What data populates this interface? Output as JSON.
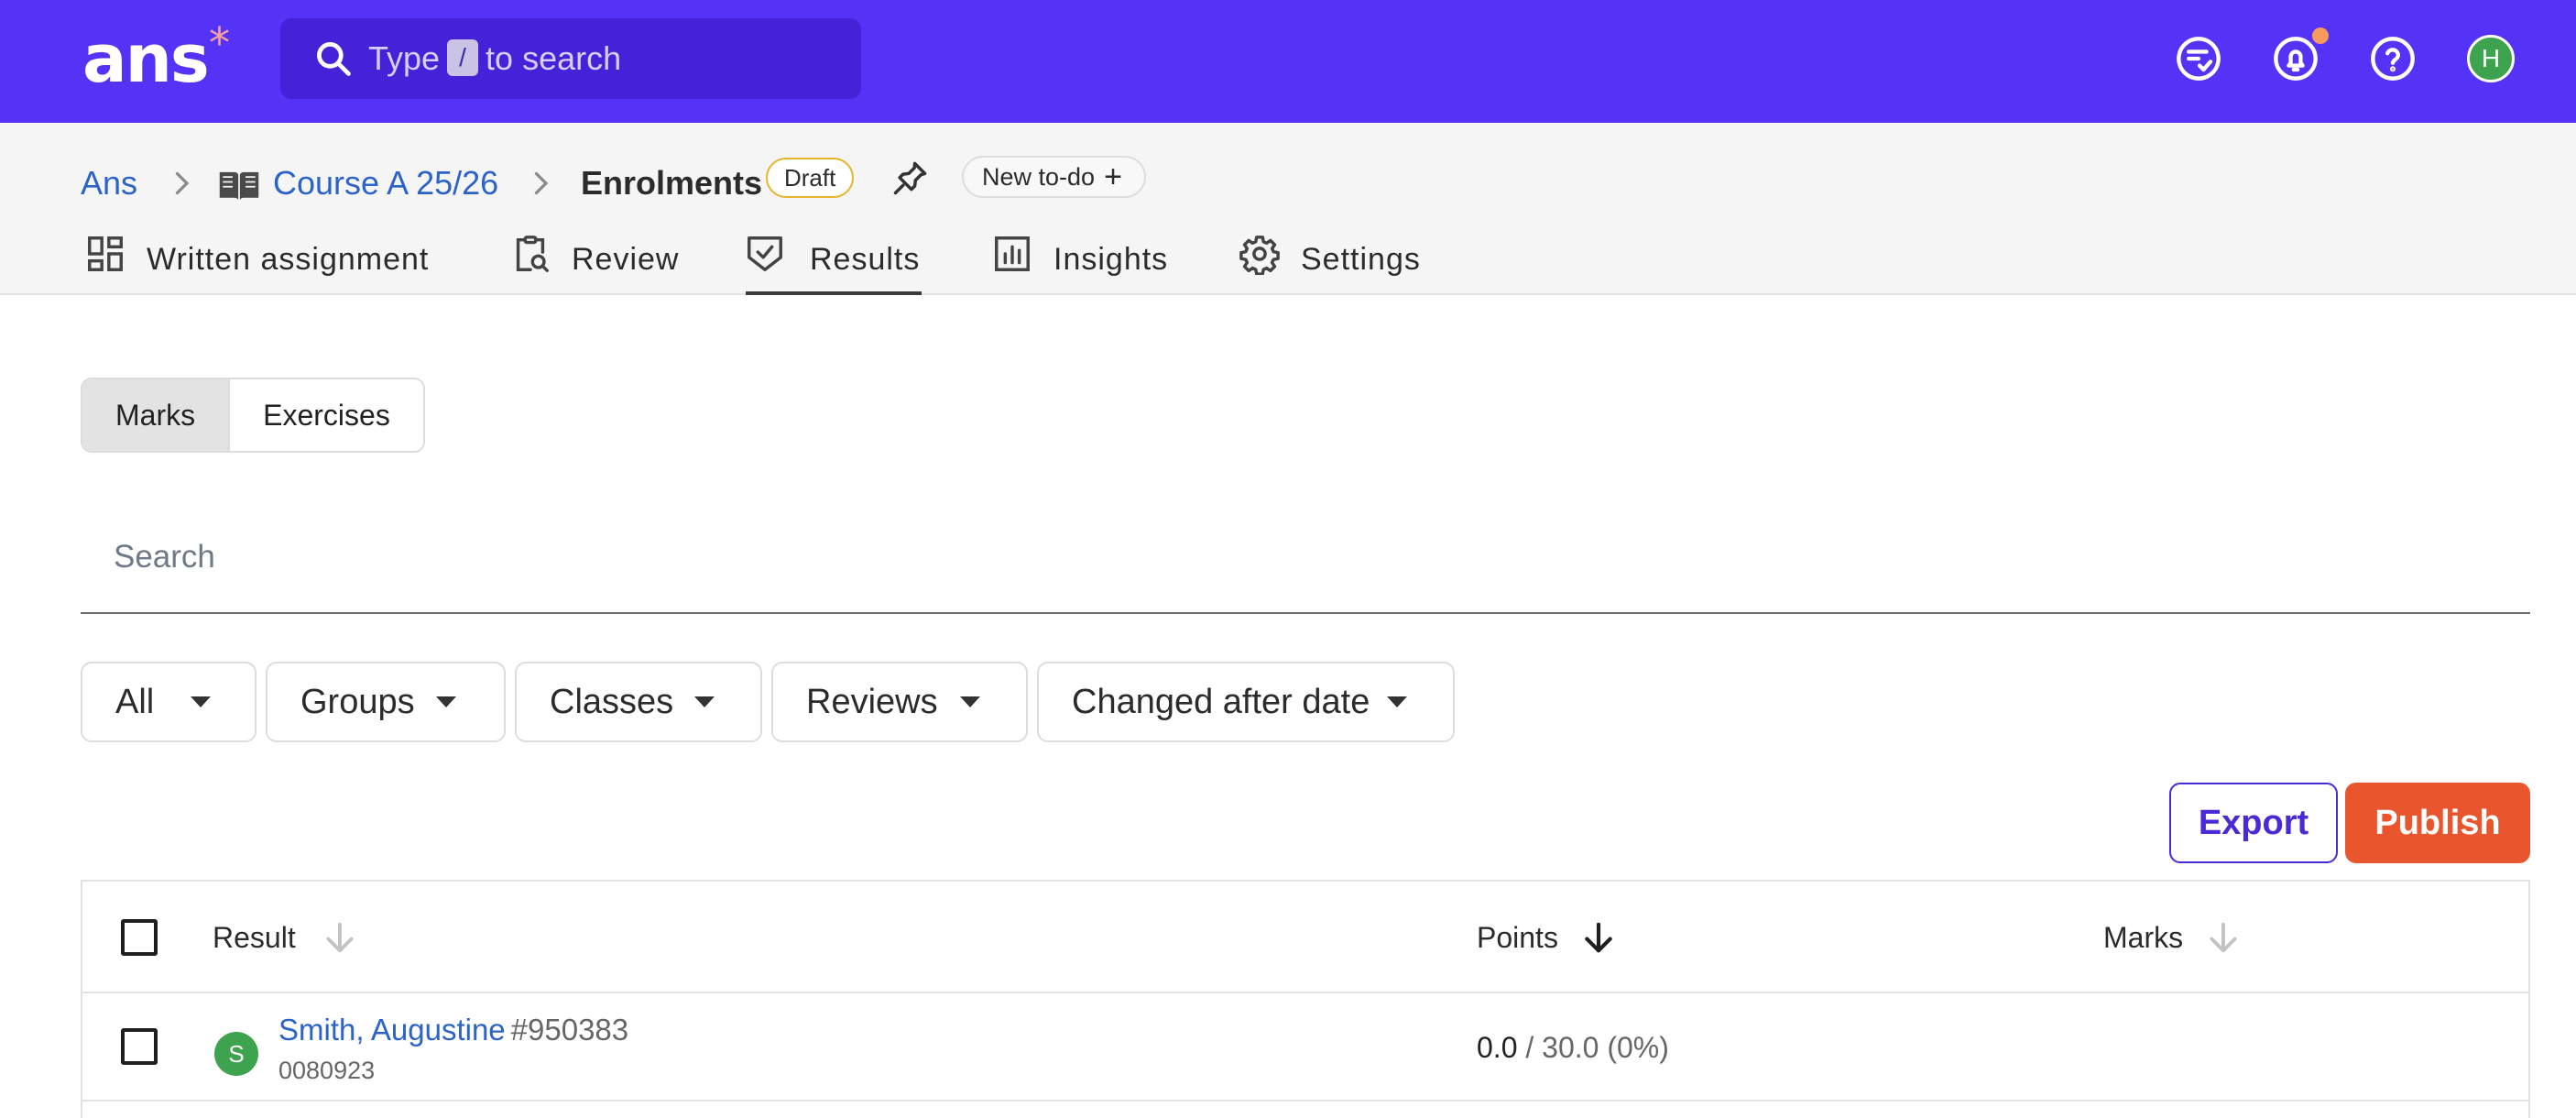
{
  "topbar": {
    "logo": "ans",
    "logo_mark": "*",
    "search": {
      "prefix": "Type",
      "key": "/",
      "suffix": "to search"
    },
    "icons": [
      "todo-list-icon",
      "bell-icon",
      "help-icon"
    ],
    "avatar_initial": "H",
    "colors": {
      "bar": "#5533f6",
      "notification_dot": "#f79a5c",
      "avatar": "#3ea34f"
    }
  },
  "breadcrumb": {
    "root": "Ans",
    "course": "Course A 25/26",
    "current": "Enrolments",
    "status_badge": "Draft",
    "todo_label": "New to-do"
  },
  "tabs": [
    {
      "label": "Written assignment",
      "icon": "dashboard-icon"
    },
    {
      "label": "Review",
      "icon": "clipboard-search-icon"
    },
    {
      "label": "Results",
      "icon": "shield-check-icon",
      "active": true
    },
    {
      "label": "Insights",
      "icon": "bar-chart-icon"
    },
    {
      "label": "Settings",
      "icon": "gear-icon"
    }
  ],
  "view_toggle": {
    "options": [
      "Marks",
      "Exercises"
    ],
    "selected": "Marks"
  },
  "search": {
    "placeholder": "Search"
  },
  "filters": [
    "All",
    "Groups",
    "Classes",
    "Reviews",
    "Changed after date"
  ],
  "actions": {
    "export": "Export",
    "publish": "Publish",
    "publish_color": "#e9562d",
    "export_color": "#4a2ad6"
  },
  "table": {
    "columns": [
      "Result",
      "Points",
      "Marks"
    ],
    "active_sort": "Points",
    "rows": [
      {
        "avatar_initial": "S",
        "name": "Smith, Augustine",
        "number": "#950383",
        "student_id": "0080923",
        "points": "0.0",
        "points_total": "/ 30.0 (0%)",
        "marks": ""
      }
    ]
  }
}
